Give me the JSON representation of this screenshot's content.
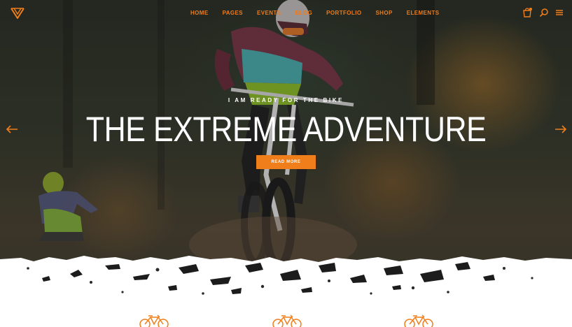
{
  "header": {
    "logo_icon": "brand-logo-chevron",
    "nav": {
      "items": [
        {
          "label": "HOME"
        },
        {
          "label": "PAGES"
        },
        {
          "label": "EVENTS"
        },
        {
          "label": "BLOG"
        },
        {
          "label": "PORTFOLIO"
        },
        {
          "label": "SHOP"
        },
        {
          "label": "ELEMENTS"
        }
      ]
    },
    "icons": [
      "cart-icon",
      "search-icon",
      "menu-icon"
    ]
  },
  "hero": {
    "kicker": "I AM READY FOR THE BIKE",
    "headline": "THE EXTREME ADVENTURE",
    "cta_label": "READ MORE",
    "prev_icon": "arrow-left-icon",
    "next_icon": "arrow-right-icon"
  },
  "features": {
    "icons": [
      "bicycle-icon",
      "bicycle-icon",
      "bicycle-icon"
    ]
  },
  "colors": {
    "accent": "#f07e1a",
    "nav_text": "#ee7b1c",
    "headline": "#ffffff",
    "background_bottom": "#ffffff"
  }
}
